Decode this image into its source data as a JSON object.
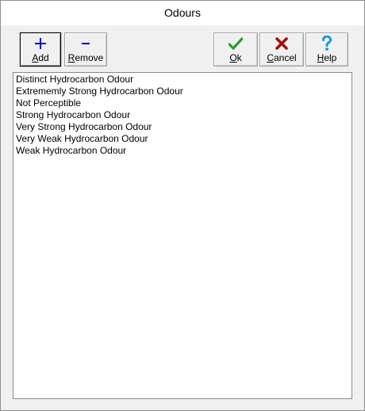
{
  "window": {
    "title": "Odours"
  },
  "toolbar": {
    "add": {
      "label": "Add",
      "icon": "plus-icon",
      "color": "#0000c0"
    },
    "remove": {
      "label": "Remove",
      "icon": "minus-icon",
      "color": "#0000c0"
    },
    "ok": {
      "label": "Ok",
      "icon": "checkmark-icon",
      "color": "#2f9a2f"
    },
    "cancel": {
      "label": "Cancel",
      "icon": "x-icon",
      "color": "#a01010"
    },
    "help": {
      "label": "Help",
      "icon": "question-mark-icon",
      "color": "#1a9ad6"
    }
  },
  "list": {
    "items": [
      "Distinct Hydrocarbon Odour",
      "Extrememly Strong Hydrocarbon Odour",
      "Not Perceptible",
      "Strong Hydrocarbon Odour",
      "Very Strong Hydrocarbon Odour",
      "Very Weak Hydrocarbon Odour",
      "Weak Hydrocarbon Odour"
    ]
  }
}
